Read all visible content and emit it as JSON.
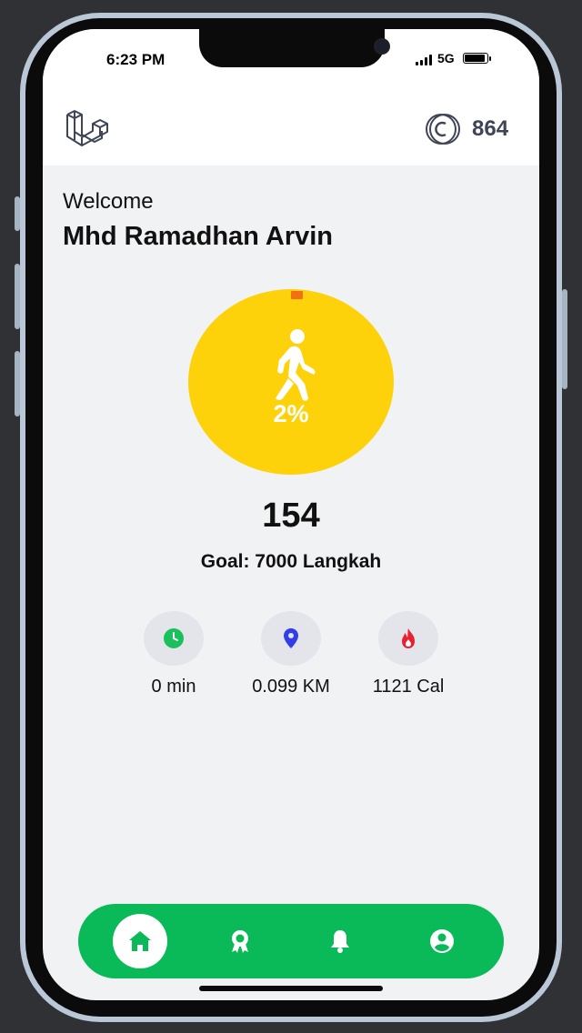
{
  "status_bar": {
    "time": "6:23 PM",
    "network": "5G"
  },
  "header": {
    "logo_icon": "laravel-logo",
    "coin_icon": "coin-icon",
    "coins": "864"
  },
  "greeting": {
    "welcome": "Welcome",
    "name": "Mhd Ramadhan Arvin"
  },
  "activity": {
    "progress_percent": 2,
    "percent_label": "2%",
    "steps": "154",
    "goal_label": "Goal: 7000 Langkah",
    "ring_color": "#fdd20a",
    "marker_color": "#f26f14",
    "icon": "walking-person-icon"
  },
  "stats": [
    {
      "icon": "clock-icon",
      "label": "0 min",
      "color": "#19c05b"
    },
    {
      "icon": "location-pin-icon",
      "label": "0.099 KM",
      "color": "#2f3ee6"
    },
    {
      "icon": "flame-icon",
      "label": "1121 Cal",
      "color": "#e8202f"
    }
  ],
  "bottom_nav": {
    "color": "#0ab957",
    "items": [
      {
        "icon": "home-icon",
        "active": true
      },
      {
        "icon": "award-icon",
        "active": false
      },
      {
        "icon": "bell-icon",
        "active": false
      },
      {
        "icon": "profile-icon",
        "active": false
      }
    ]
  }
}
